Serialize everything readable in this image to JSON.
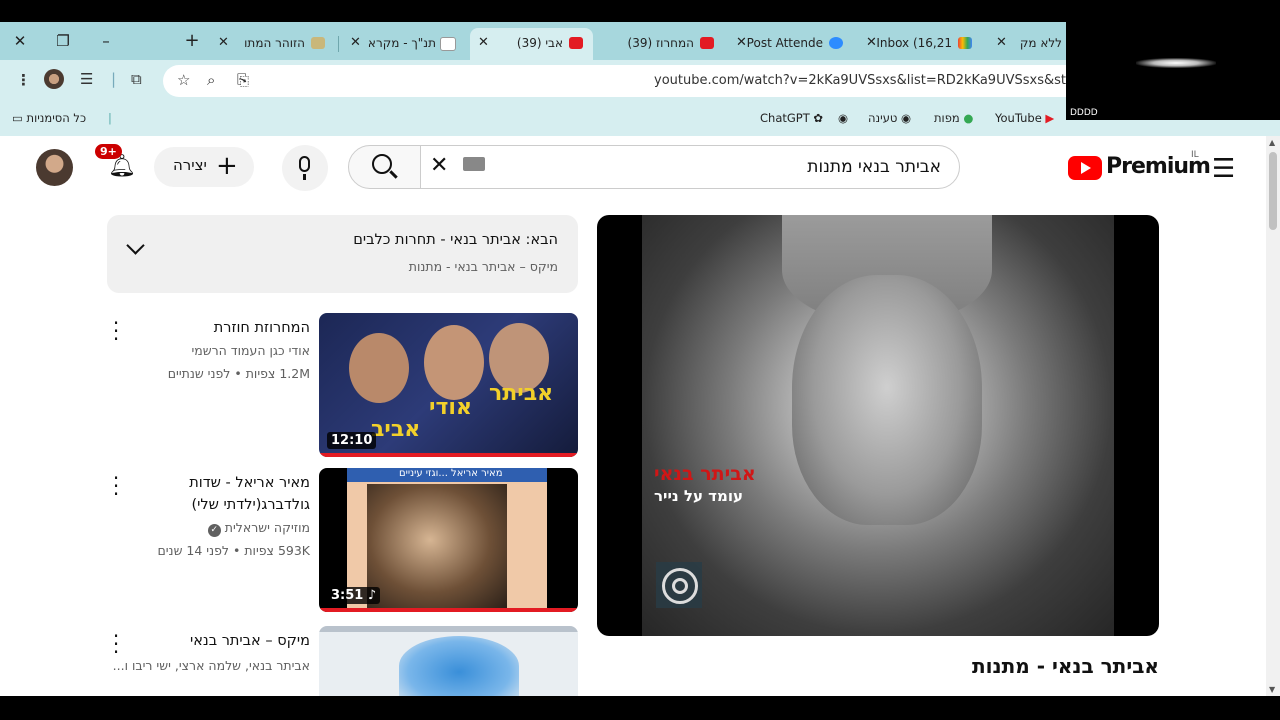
{
  "tabs": [
    {
      "title": "ללא מק"
    },
    {
      "title": "Inbox (16,21"
    },
    {
      "title": "Post Attende"
    },
    {
      "title": "המחרוז (39)"
    },
    {
      "title": "אבי (39)"
    },
    {
      "title": "תנ\"ך - מקרא"
    },
    {
      "title": "הזוהר המתו"
    }
  ],
  "toolbar": {
    "url": "youtube.com/watch?v=2kKa9UVSsxs&list=RD2kKa9UVSsxs&st"
  },
  "bookmarks": {
    "all": "כל הסימניות",
    "items": [
      "YouTube",
      "מפות",
      "טעינה",
      "ChatGPT"
    ]
  },
  "camera": {
    "label": "DDDD"
  },
  "youtube": {
    "logo": "Premium",
    "region": "IL",
    "search_value": "אביתר בנאי מתנות",
    "create_label": "יצירה",
    "notif_count": "9+"
  },
  "nextup": {
    "title": "הבא: אביתר בנאי - תחרות כלבים",
    "subtitle": "מיקס – אביתר בנאי - מתנות"
  },
  "videos": [
    {
      "title": "המחרוזת חוזרת",
      "channel": "אודי כגן העמוד הרשמי",
      "stats": "1.2M צפיות • לפני שנתיים",
      "duration": "12:10",
      "thumb_names": [
        "אביתר",
        "אודי",
        "אביב"
      ]
    },
    {
      "title": "מאיר אריאל - שדות גולדברג(ילדתי שלי)",
      "channel": "מוזיקה ישראלית",
      "stats": "593K צפיות • לפני 14 שנים",
      "duration": "3:51",
      "thumb_caption": "מאיר אריאל ...וגזי עיניים"
    },
    {
      "title": "מיקס – אביתר בנאי",
      "channel": "אביתר בנאי, שלמה ארצי, ישי ריבו ו..."
    }
  ],
  "player": {
    "album_artist": "אביתר בנאי",
    "album_name": "עומד על נייר"
  },
  "song_title": "אביתר בנאי - מתנות",
  "colors": {
    "accent": "#e31b23",
    "tabbar": "#a7d7dd",
    "toolbar": "#d6eef0"
  }
}
